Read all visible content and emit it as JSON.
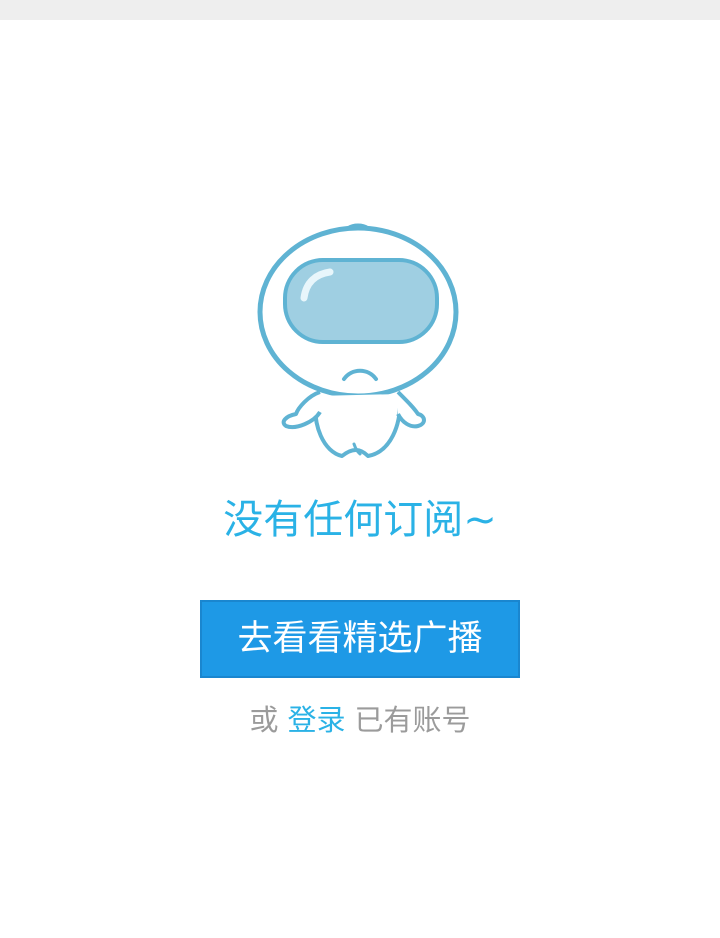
{
  "empty_state": {
    "illustration": "astronaut-mascot",
    "message": "没有任何订阅~",
    "primary_button_label": "去看看精选广播",
    "secondary": {
      "prefix": "或",
      "link_label": "登录",
      "suffix": "已有账号"
    }
  },
  "colors": {
    "accent_text": "#2ab2e6",
    "button_bg": "#1e99e6",
    "muted_text": "#9b9b9b",
    "mascot_stroke": "#5fb3d3",
    "mascot_visor": "#9fcfe2",
    "top_strip": "#eeeeee"
  }
}
